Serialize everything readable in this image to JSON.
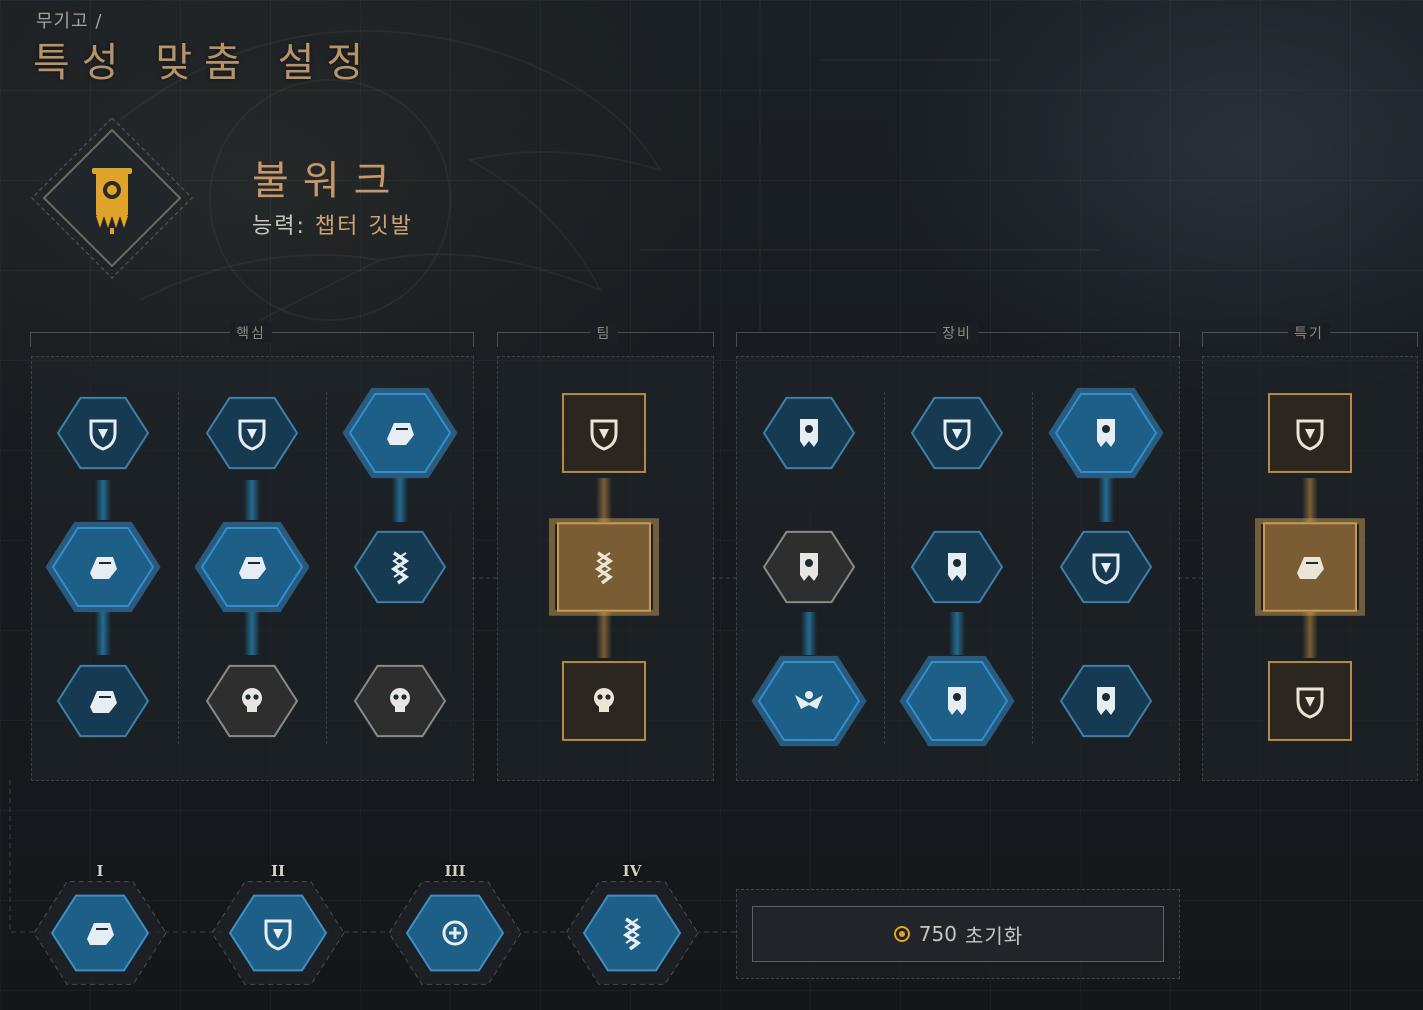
{
  "breadcrumb": "무기고 /",
  "page_title": "특성 맞춤 설정",
  "class": {
    "name": "불워크",
    "ability_prefix": "능력:",
    "ability_name": "챕터 깃발",
    "emblem_icon": "chapter-banner-icon"
  },
  "sections": {
    "core": "핵심",
    "team": "팀",
    "gear": "장비",
    "signature": "특기"
  },
  "colors": {
    "active_blue": "#1d5f86",
    "glow_blue": "#2f8fd0",
    "inactive_blue": "#163a52",
    "gold": "#b58a4a",
    "gold_active": "#c99a52",
    "locked_gray": "#3a3a3a",
    "title_gold": "#b89268"
  },
  "perks": {
    "core": [
      [
        {
          "icon": "helix-shield-icon",
          "state": "available"
        },
        {
          "icon": "fist-impact-icon",
          "state": "selected"
        },
        {
          "icon": "armored-fist-icon",
          "state": "available"
        }
      ],
      [
        {
          "icon": "shield-slash-icon",
          "state": "available"
        },
        {
          "icon": "helmet-strike-icon",
          "state": "selected"
        },
        {
          "icon": "skull-shield-icon",
          "state": "locked"
        }
      ],
      [
        {
          "icon": "fist-swing-icon",
          "state": "selected"
        },
        {
          "icon": "chain-link-icon",
          "state": "available"
        },
        {
          "icon": "skull-crosshair-icon",
          "state": "locked"
        }
      ]
    ],
    "team": [
      {
        "icon": "hourglass-shield-icon",
        "state": "available"
      },
      {
        "icon": "helix-hourglass-icon",
        "state": "selected"
      },
      {
        "icon": "skull-shield-small-icon",
        "state": "available"
      }
    ],
    "gear": [
      [
        {
          "icon": "banner-wings-icon",
          "state": "available"
        },
        {
          "icon": "banner-hourglass-icon",
          "state": "locked"
        },
        {
          "icon": "eagle-strike-icon",
          "state": "selected"
        }
      ],
      [
        {
          "icon": "shield-shatter-icon",
          "state": "available"
        },
        {
          "icon": "banner-shield-icon",
          "state": "available"
        },
        {
          "icon": "banner-upgrade-icon",
          "state": "selected"
        }
      ],
      [
        {
          "icon": "winged-banner-icon",
          "state": "selected"
        },
        {
          "icon": "shield-dash-icon",
          "state": "available"
        },
        {
          "icon": "banner-arrows-icon",
          "state": "available"
        }
      ]
    ],
    "signature": [
      {
        "icon": "shattered-shield-icon",
        "state": "available"
      },
      {
        "icon": "target-marine-icon",
        "state": "selected"
      },
      {
        "icon": "flame-shield-icon",
        "state": "available"
      }
    ]
  },
  "tiers": [
    {
      "label": "I",
      "icon": "fist-swing-icon"
    },
    {
      "label": "II",
      "icon": "shield-chevron-icon"
    },
    {
      "label": "III",
      "icon": "bolter-upgrade-icon"
    },
    {
      "label": "IV",
      "icon": "helix-blade-icon"
    }
  ],
  "reset": {
    "cost": "750",
    "label": "초기화",
    "currency_icon": "requisition-coin-icon"
  }
}
